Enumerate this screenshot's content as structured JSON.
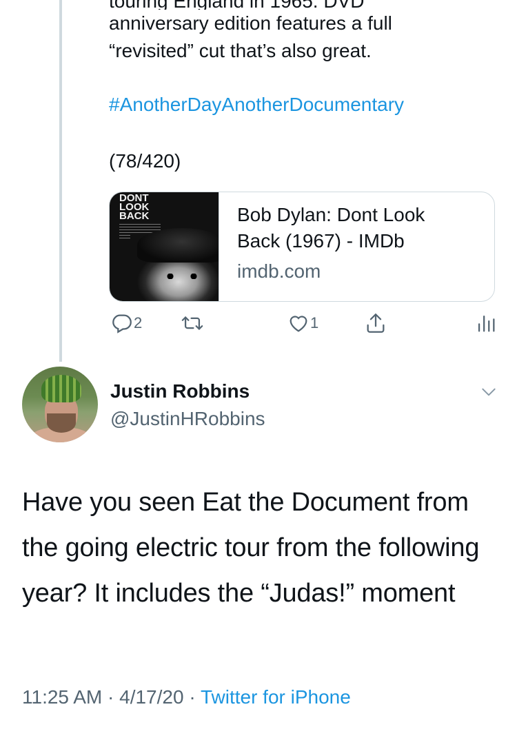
{
  "tweet1": {
    "partial_line": "touring England in 1965. DVD",
    "text_lines": [
      "anniversary edition features a full",
      "“revisited” cut that’s also great."
    ],
    "hashtag": "#AnotherDayAnotherDocumentary",
    "counter": "(78/420)",
    "card": {
      "poster_title": "DONT LOOK BACK",
      "title": "Bob Dylan: Dont Look Back (1967) - IMDb",
      "domain": "imdb.com"
    },
    "actions": {
      "reply_count": "2",
      "retweet_count": "",
      "like_count": "1"
    }
  },
  "tweet2": {
    "author_name": "Justin Robbins",
    "author_handle": "@JustinHRobbins",
    "text": "Have you seen Eat the Document from the going electric tour from the following year?  It includes the “Judas!” moment",
    "time": "11:25 AM",
    "date": "4/17/20",
    "separator": "·",
    "source": "Twitter for iPhone"
  },
  "colors": {
    "link": "#1b95e0",
    "secondary_text": "#536471",
    "primary_text": "#0f1419",
    "border": "#cfd9de"
  },
  "icons": [
    "reply-icon",
    "retweet-icon",
    "like-icon",
    "share-icon",
    "analytics-icon",
    "chevron-down-icon"
  ]
}
